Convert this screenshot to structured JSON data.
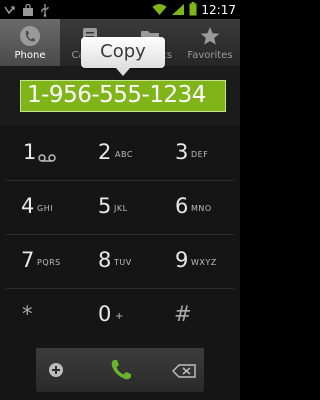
{
  "status_bar": {
    "time": "12:17",
    "left_icons": [
      "phone-missed-icon",
      "shopping-bag-icon",
      "usb-icon"
    ],
    "right_icons": [
      "wifi-icon",
      "signal-icon",
      "battery-icon"
    ]
  },
  "tabs": [
    {
      "label": "Phone",
      "icon": "phone-icon",
      "active": true
    },
    {
      "label": "Call log",
      "icon": "call-log-icon",
      "active": false
    },
    {
      "label": "Contacts",
      "icon": "contacts-icon",
      "active": false
    },
    {
      "label": "Favorites",
      "icon": "star-icon",
      "active": false
    }
  ],
  "dialer": {
    "number": "1-956-555-1234",
    "copy_label": "Copy"
  },
  "keypad": [
    {
      "digit": "1",
      "letters": "",
      "voicemail": true
    },
    {
      "digit": "2",
      "letters": "ABC"
    },
    {
      "digit": "3",
      "letters": "DEF"
    },
    {
      "digit": "4",
      "letters": "GHI"
    },
    {
      "digit": "5",
      "letters": "JKL"
    },
    {
      "digit": "6",
      "letters": "MNO"
    },
    {
      "digit": "7",
      "letters": "PQRS"
    },
    {
      "digit": "8",
      "letters": "TUV"
    },
    {
      "digit": "9",
      "letters": "WXYZ"
    },
    {
      "digit": "*",
      "letters": ""
    },
    {
      "digit": "0",
      "letters": "+"
    },
    {
      "digit": "#",
      "letters": ""
    }
  ],
  "colors": {
    "accent_green": "#7fb518",
    "call_green": "#6ab42c"
  }
}
